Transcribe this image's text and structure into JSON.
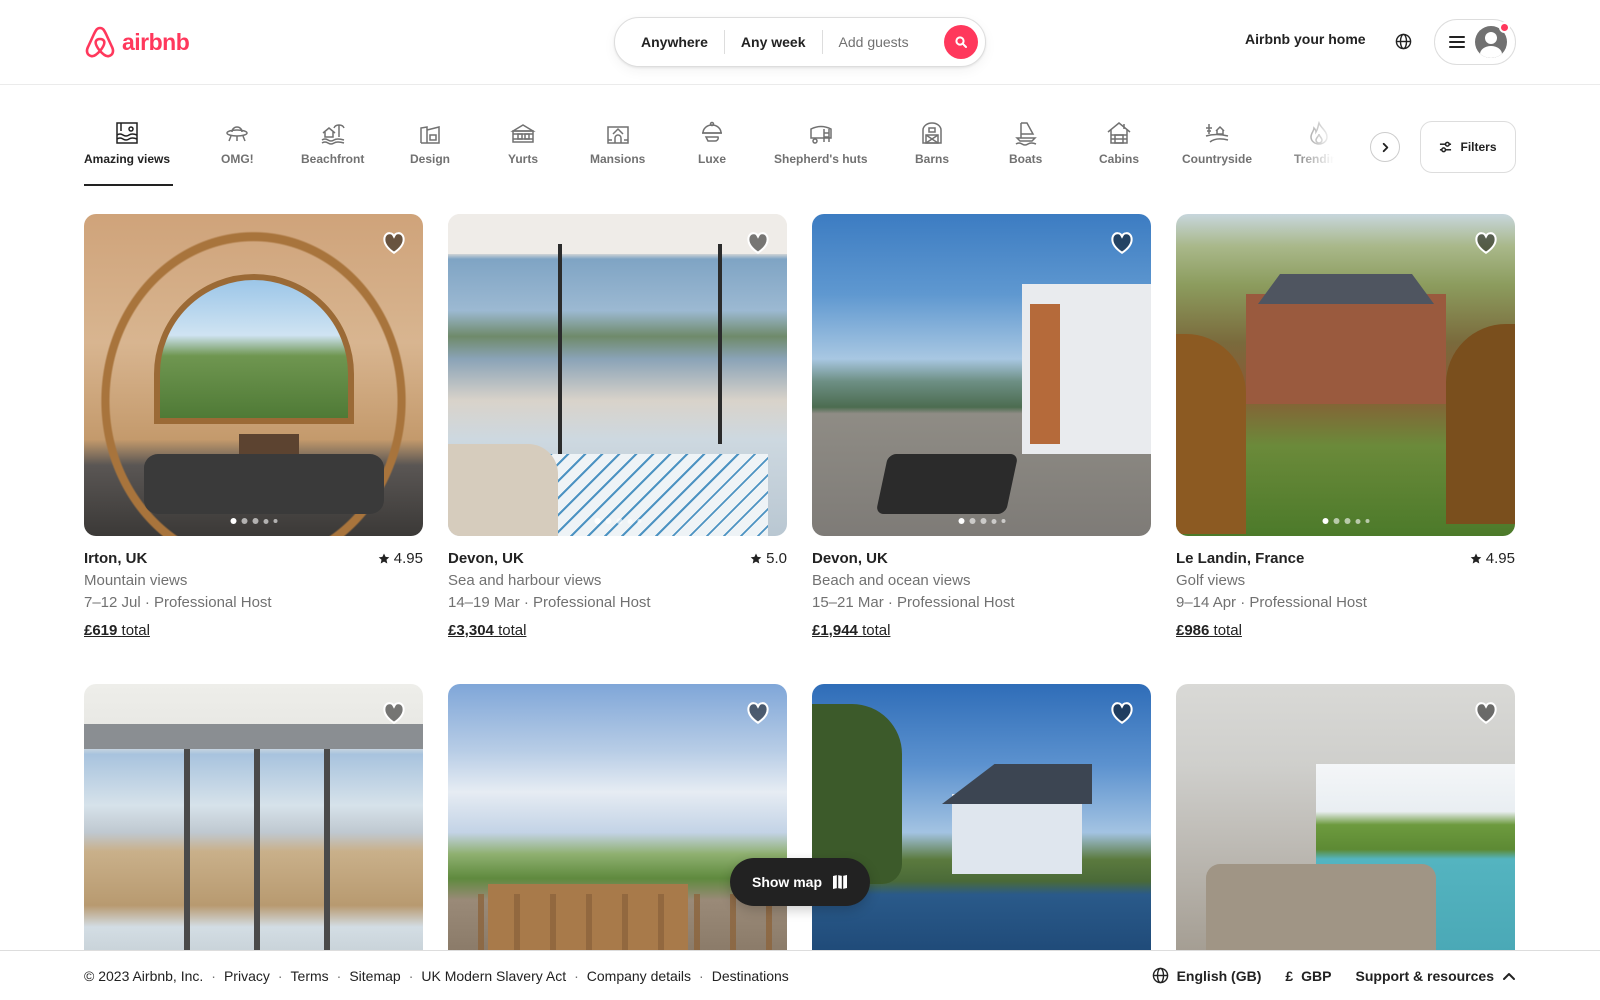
{
  "brand": {
    "name": "airbnb",
    "color": "#FF385C"
  },
  "search": {
    "where": "Anywhere",
    "when": "Any week",
    "guests_placeholder": "Add guests"
  },
  "header": {
    "host_link": "Airbnb your home",
    "notification": true
  },
  "categories": {
    "active_index": 0,
    "items": [
      {
        "label": "Amazing views",
        "icon": "amazing-views-icon"
      },
      {
        "label": "OMG!",
        "icon": "ufo-icon"
      },
      {
        "label": "Beachfront",
        "icon": "beachfront-icon"
      },
      {
        "label": "Design",
        "icon": "design-icon"
      },
      {
        "label": "Yurts",
        "icon": "yurt-icon"
      },
      {
        "label": "Mansions",
        "icon": "mansion-icon"
      },
      {
        "label": "Luxe",
        "icon": "cloche-icon"
      },
      {
        "label": "Shepherd's huts",
        "icon": "hut-icon"
      },
      {
        "label": "Barns",
        "icon": "barn-icon"
      },
      {
        "label": "Boats",
        "icon": "boat-icon"
      },
      {
        "label": "Cabins",
        "icon": "cabin-icon"
      },
      {
        "label": "Countryside",
        "icon": "countryside-icon"
      },
      {
        "label": "Trending",
        "icon": "flame-icon"
      }
    ],
    "filters_label": "Filters"
  },
  "listings": [
    {
      "location": "Irton, UK",
      "rating": "4.95",
      "description": "Mountain views",
      "dates_host": "7–12 Jul · Professional Host",
      "price": "£619",
      "price_suffix": "total",
      "photo_count": 5,
      "photo_index": 0
    },
    {
      "location": "Devon, UK",
      "rating": "5.0",
      "description": "Sea and harbour views",
      "dates_host": "14–19 Mar · Professional Host",
      "price": "£3,304",
      "price_suffix": "total",
      "photo_count": 5,
      "photo_index": 0
    },
    {
      "location": "Devon, UK",
      "rating": null,
      "description": "Beach and ocean views",
      "dates_host": "15–21 Mar · Professional Host",
      "price": "£1,944",
      "price_suffix": "total",
      "photo_count": 5,
      "photo_index": 0
    },
    {
      "location": "Le Landin, France",
      "rating": "4.95",
      "description": "Golf views",
      "dates_host": "9–14 Apr · Professional Host",
      "price": "£986",
      "price_suffix": "total",
      "photo_count": 5,
      "photo_index": 0
    },
    {
      "location": null
    },
    {
      "location": null
    },
    {
      "location": null
    },
    {
      "location": null
    }
  ],
  "show_map": {
    "label": "Show map"
  },
  "footer": {
    "copyright": "© 2023 Airbnb, Inc.",
    "links": [
      "Privacy",
      "Terms",
      "Sitemap",
      "UK Modern Slavery Act",
      "Company details",
      "Destinations"
    ],
    "language": "English (GB)",
    "currency_symbol": "£",
    "currency": "GBP",
    "support": "Support & resources"
  }
}
